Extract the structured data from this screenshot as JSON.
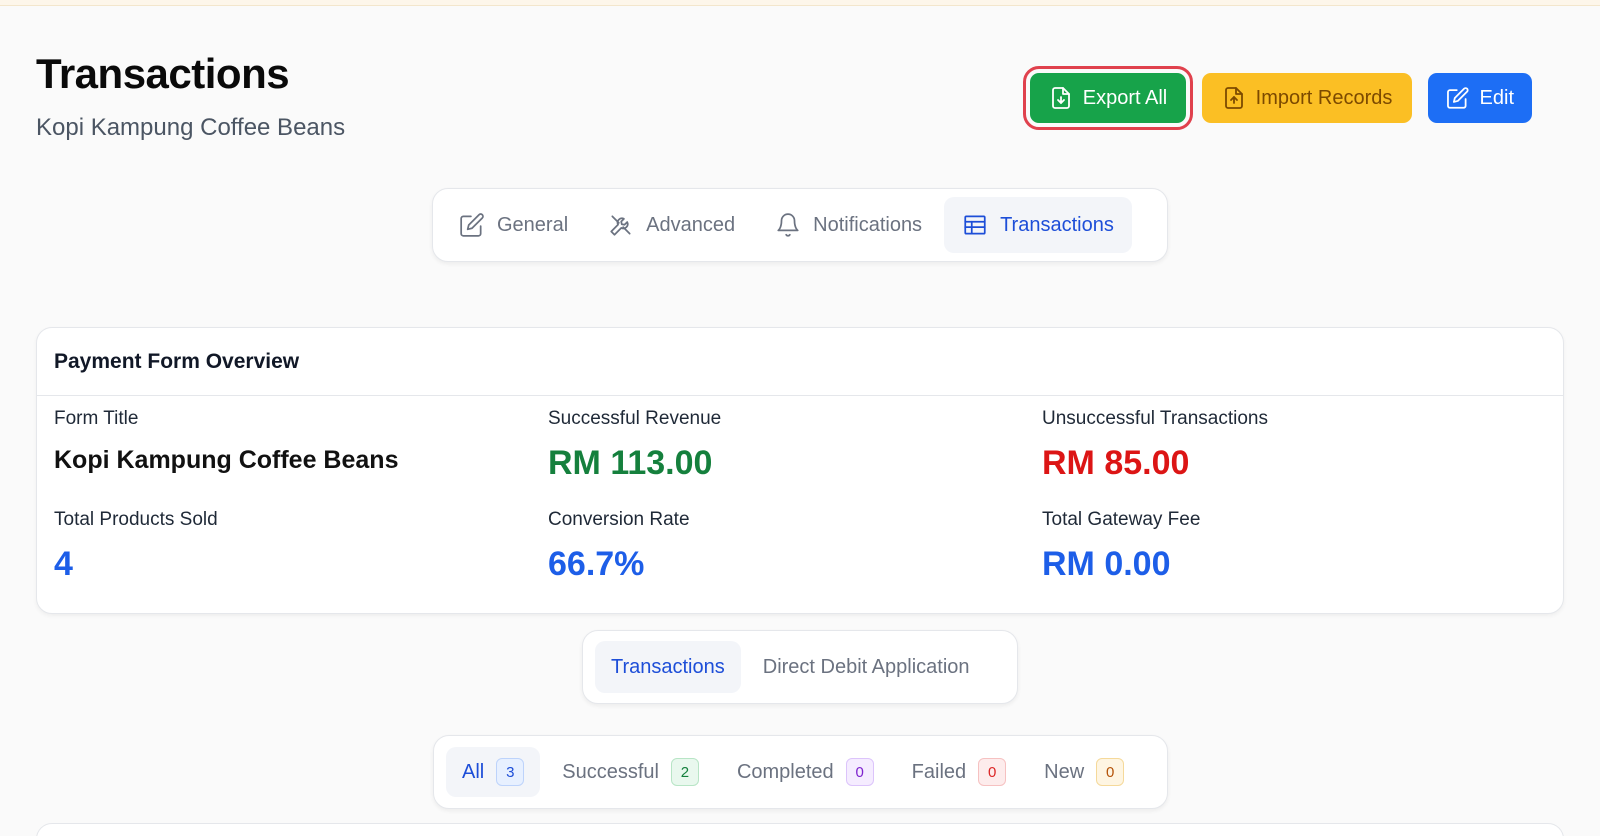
{
  "header": {
    "title": "Transactions",
    "subtitle": "Kopi Kampung Coffee Beans"
  },
  "actions": {
    "export_label": "Export All",
    "import_label": "Import Records",
    "edit_label": "Edit"
  },
  "tabs": [
    {
      "label": "General",
      "icon": "pencil-square-icon"
    },
    {
      "label": "Advanced",
      "icon": "tools-icon"
    },
    {
      "label": "Notifications",
      "icon": "bell-icon"
    },
    {
      "label": "Transactions",
      "icon": "table-icon",
      "active": true
    }
  ],
  "overview": {
    "heading": "Payment Form Overview",
    "form_title_label": "Form Title",
    "form_title_value": "Kopi Kampung Coffee Beans",
    "revenue_label": "Successful Revenue",
    "revenue_value": "RM 113.00",
    "unsuccessful_label": "Unsuccessful Transactions",
    "unsuccessful_value": "RM 85.00",
    "products_label": "Total Products Sold",
    "products_value": "4",
    "conversion_label": "Conversion Rate",
    "conversion_value": "66.7%",
    "fee_label": "Total Gateway Fee",
    "fee_value": "RM 0.00"
  },
  "subtabs": [
    {
      "label": "Transactions",
      "active": true
    },
    {
      "label": "Direct Debit Application"
    }
  ],
  "filters": [
    {
      "label": "All",
      "count": "3",
      "active": true
    },
    {
      "label": "Successful",
      "count": "2"
    },
    {
      "label": "Completed",
      "count": "0"
    },
    {
      "label": "Failed",
      "count": "0"
    },
    {
      "label": "New",
      "count": "0"
    }
  ],
  "colors": {
    "export": "#17a34a",
    "import": "#fbbf24",
    "edit": "#1d6ef5",
    "positive": "#15803d",
    "negative": "#dc1515",
    "accent": "#1d5ee8"
  }
}
